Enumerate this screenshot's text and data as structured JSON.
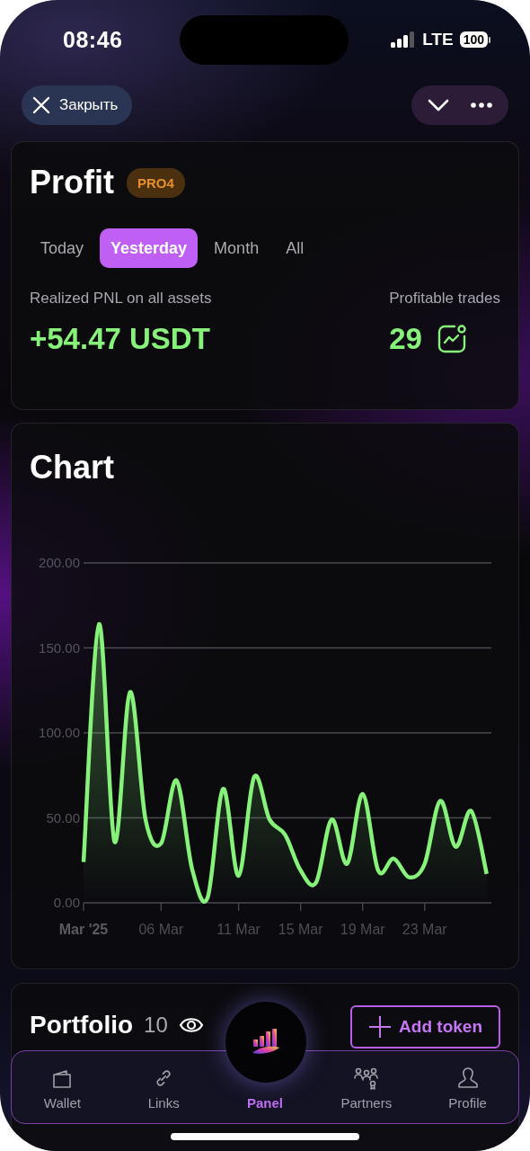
{
  "status_bar": {
    "time": "08:46",
    "network": "LTE",
    "battery": "100"
  },
  "header": {
    "close_label": "Закрыть"
  },
  "profit": {
    "title": "Profit",
    "badge": "PRO4",
    "periods": [
      {
        "label": "Today",
        "selected": false
      },
      {
        "label": "Yesterday",
        "selected": true
      },
      {
        "label": "Month",
        "selected": false
      },
      {
        "label": "All",
        "selected": false
      }
    ],
    "pnl_label": "Realized PNL on all assets",
    "pnl_value": "+54.47 USDT",
    "trades_label": "Profitable trades",
    "trades_value": "29"
  },
  "chart": {
    "title": "Chart",
    "chart_data": {
      "type": "area",
      "categories": [
        "Mar '25",
        null,
        null,
        null,
        null,
        "06 Mar",
        null,
        null,
        null,
        null,
        "11 Mar",
        null,
        null,
        null,
        "15 Mar",
        null,
        null,
        null,
        "19 Mar",
        null,
        null,
        null,
        "23 Mar",
        null,
        null,
        null,
        null
      ],
      "series": [
        {
          "color": "#86f27a",
          "values": [
            24,
            164,
            36,
            124,
            49,
            35,
            72,
            20,
            3,
            67,
            16,
            74,
            49,
            40,
            19,
            12,
            49,
            23,
            64,
            19,
            26,
            15,
            23,
            60,
            33,
            54,
            17
          ]
        }
      ],
      "ylim": [
        0,
        200
      ],
      "grid": true,
      "yticks": [
        {
          "value": 0,
          "label": "0.00"
        },
        {
          "value": 50,
          "label": "50.00"
        },
        {
          "value": 100,
          "label": "100.00"
        },
        {
          "value": 150,
          "label": "150.00"
        },
        {
          "value": 200,
          "label": "200.00"
        }
      ]
    }
  },
  "portfolio": {
    "title": "Portfolio",
    "count": "10",
    "add_button": "Add token"
  },
  "bottom_nav": {
    "items": [
      {
        "label": "Wallet",
        "selected": false
      },
      {
        "label": "Links",
        "selected": false
      },
      {
        "label": "Panel",
        "selected": true
      },
      {
        "label": "Partners",
        "selected": false
      },
      {
        "label": "Profile",
        "selected": false
      }
    ]
  }
}
